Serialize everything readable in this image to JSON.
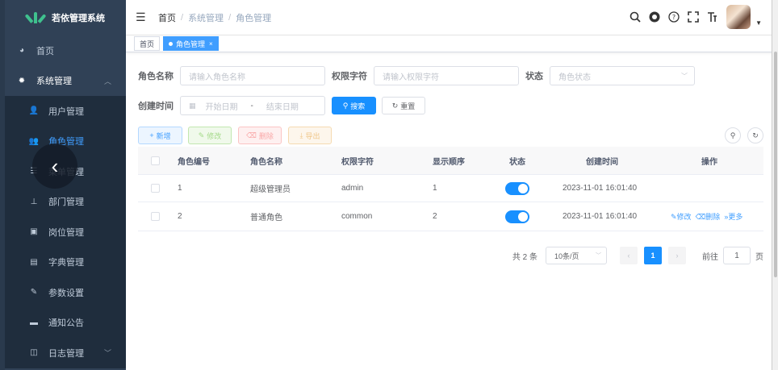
{
  "app": {
    "title": "若依管理系统"
  },
  "sidebar": {
    "items": [
      {
        "label": "首页",
        "icon": "dashboard-icon"
      },
      {
        "label": "系统管理",
        "icon": "gear-icon"
      },
      {
        "label": "用户管理",
        "icon": "user-icon"
      },
      {
        "label": "角色管理",
        "icon": "peoples-icon"
      },
      {
        "label": "菜单管理",
        "icon": "tree-table-icon"
      },
      {
        "label": "部门管理",
        "icon": "tree-icon"
      },
      {
        "label": "岗位管理",
        "icon": "post-icon"
      },
      {
        "label": "字典管理",
        "icon": "dict-icon"
      },
      {
        "label": "参数设置",
        "icon": "edit-icon"
      },
      {
        "label": "通知公告",
        "icon": "message-icon"
      },
      {
        "label": "日志管理",
        "icon": "log-icon"
      }
    ]
  },
  "breadcrumb": {
    "home": "首页",
    "level1": "系统管理",
    "level2": "角色管理"
  },
  "tags": {
    "home": "首页",
    "current": "角色管理"
  },
  "search": {
    "role_name_label": "角色名称",
    "role_name_placeholder": "请输入角色名称",
    "role_key_label": "权限字符",
    "role_key_placeholder": "请输入权限字符",
    "status_label": "状态",
    "status_placeholder": "角色状态",
    "date_label": "创建时间",
    "start_placeholder": "开始日期",
    "date_sep": "-",
    "end_placeholder": "结束日期",
    "search_btn": "搜索",
    "reset_btn": "重置"
  },
  "toolbar": {
    "add": "新增",
    "edit": "修改",
    "delete": "删除",
    "export": "导出"
  },
  "table": {
    "headers": [
      "角色编号",
      "角色名称",
      "权限字符",
      "显示顺序",
      "状态",
      "创建时间",
      "操作"
    ],
    "rows": [
      {
        "id": "1",
        "name": "超级管理员",
        "key": "admin",
        "sort": "1",
        "status": true,
        "created": "2023-11-01 16:01:40",
        "ops": []
      },
      {
        "id": "2",
        "name": "普通角色",
        "key": "common",
        "sort": "2",
        "status": true,
        "created": "2023-11-01 16:01:40",
        "ops": [
          "修改",
          "删除",
          "更多"
        ]
      }
    ]
  },
  "pagination": {
    "total": "共 2 条",
    "page_size": "10条/页",
    "current": "1",
    "goto_prefix": "前往",
    "goto_value": "1",
    "goto_suffix": "页"
  },
  "colors": {
    "sidebar_bg": "#304156",
    "primary": "#1890ff",
    "active_menu": "#409eff"
  }
}
